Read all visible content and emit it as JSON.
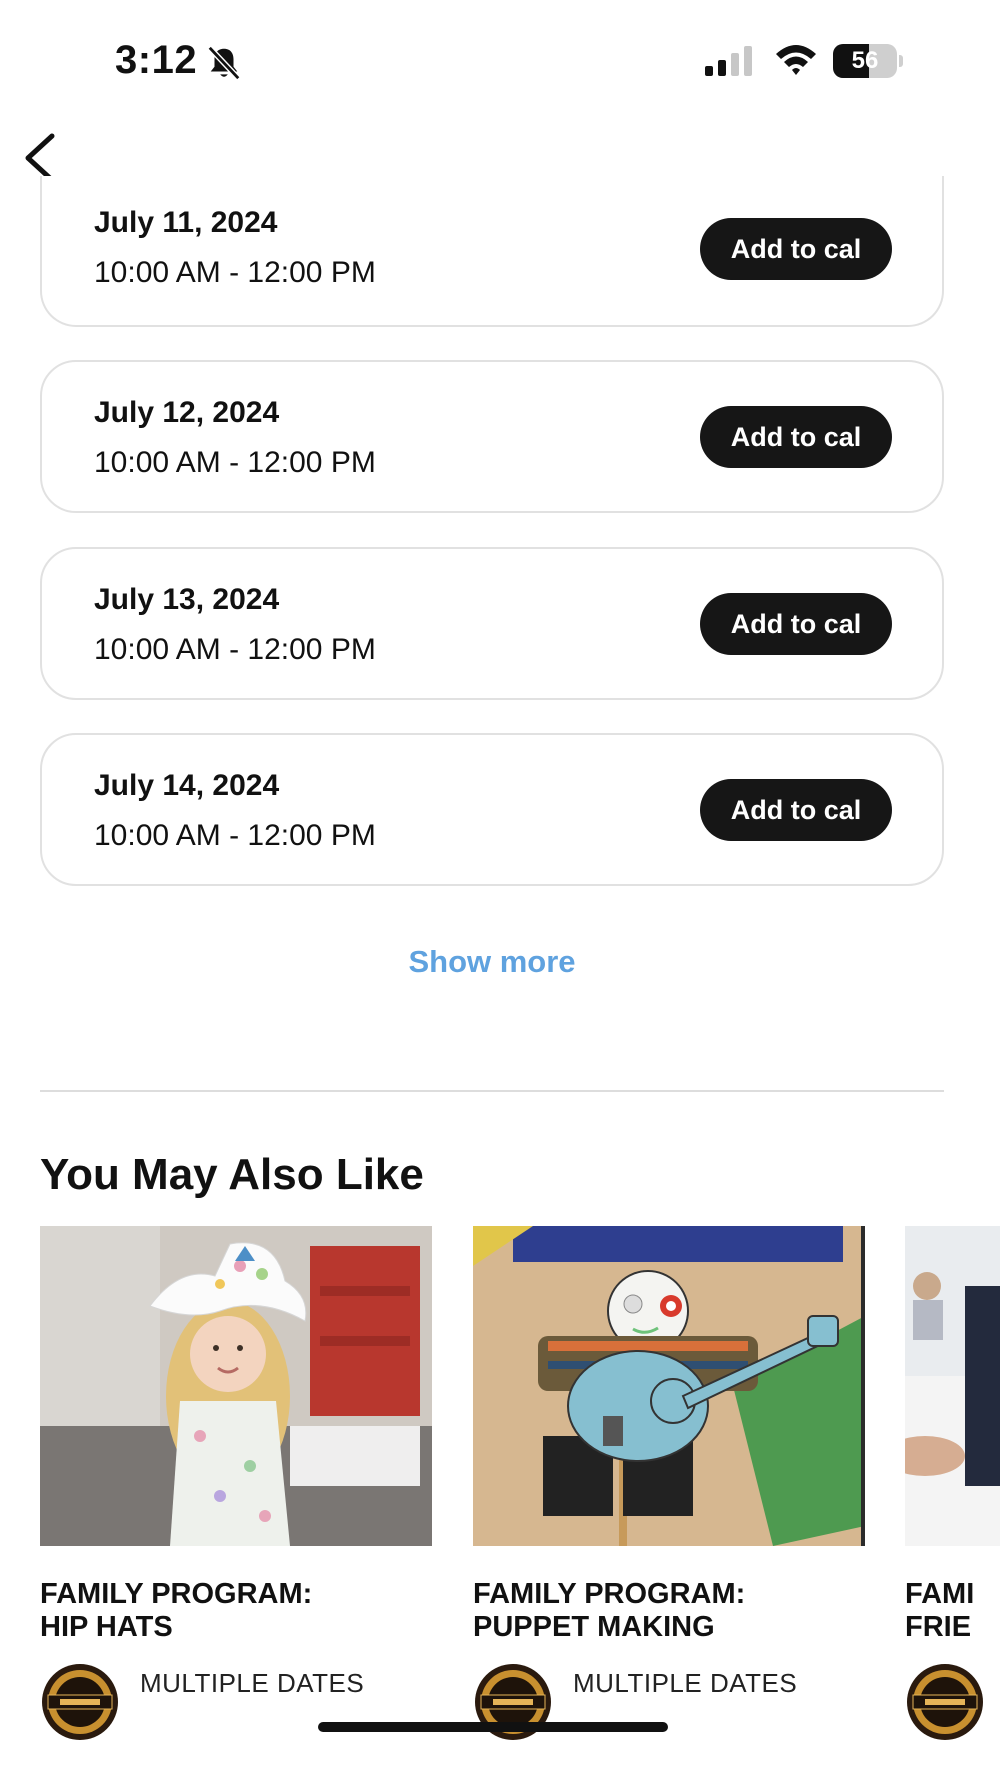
{
  "status_bar": {
    "time": "3:12",
    "battery_percent": "56",
    "battery_level": 0.56
  },
  "dates": [
    {
      "date": "July 11, 2024",
      "time": "10:00 AM - 12:00 PM",
      "button": "Add to cal"
    },
    {
      "date": "July 12, 2024",
      "time": "10:00 AM - 12:00 PM",
      "button": "Add to cal"
    },
    {
      "date": "July 13, 2024",
      "time": "10:00 AM - 12:00 PM",
      "button": "Add to cal"
    },
    {
      "date": "July 14, 2024",
      "time": "10:00 AM - 12:00 PM",
      "button": "Add to cal"
    }
  ],
  "show_more": "Show more",
  "section_title": "You May Also Like",
  "related": [
    {
      "title": "FAMILY PROGRAM:\nHIP HATS",
      "dates": "MULTIPLE DATES",
      "logo": "country-music-hall-of-fame-logo"
    },
    {
      "title": "FAMILY PROGRAM:\nPUPPET MAKING",
      "dates": "MULTIPLE DATES",
      "logo": "country-music-hall-of-fame-logo"
    },
    {
      "title": "FAMI\nFRIE",
      "dates": "",
      "logo": "country-music-hall-of-fame-logo"
    }
  ],
  "colors": {
    "button_bg": "#161616",
    "link": "#5fa2df",
    "card_border": "#e1e1e1"
  }
}
